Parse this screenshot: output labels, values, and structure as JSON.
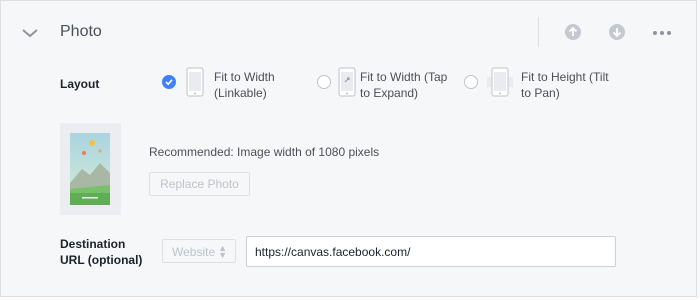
{
  "header": {
    "title": "Photo",
    "collapse_icon": "chevron-down-icon",
    "move_up_icon": "arrow-up-circle-icon",
    "move_down_icon": "arrow-down-circle-icon",
    "more_icon": "more-horizontal-icon"
  },
  "layout": {
    "label": "Layout",
    "selected": 0,
    "options": [
      {
        "line1": "Fit to Width",
        "line2": "(Linkable)",
        "icon": "phone-fit-width-icon"
      },
      {
        "line1": "Fit to Width (Tap",
        "line2": "to Expand)",
        "icon": "phone-tap-expand-icon"
      },
      {
        "line1": "Fit to Height (Tilt",
        "line2": "to Pan)",
        "icon": "phone-tilt-pan-icon"
      }
    ]
  },
  "photo": {
    "recommendation": "Recommended: Image width of 1080 pixels",
    "replace_label": "Replace Photo"
  },
  "destination": {
    "label_line1": "Destination",
    "label_line2": "URL (optional)",
    "type_selected": "Website",
    "url_value": "https://canvas.facebook.com/"
  },
  "colors": {
    "accent": "#4080ff",
    "border": "#dddfe2",
    "background": "#f6f7f9"
  }
}
